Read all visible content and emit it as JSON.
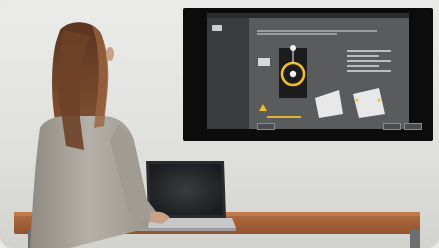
{
  "scene": {
    "caption": "",
    "colors": {
      "wall": "#e6e6e4",
      "desk": "#a5623a",
      "sweater": "#a8a39b",
      "hair": "#7b4a2b",
      "monitor_frame": "#0c0c0d",
      "screen_bg": "#5a5b5d",
      "accent_yellow": "#f2bd2a"
    },
    "icons": {
      "calibration_target": "ring-with-center-dot",
      "colorimeter": "puck-device"
    }
  },
  "monitor_ui": {
    "window_title": "",
    "sidebar_title": "",
    "steps": [],
    "heading": "",
    "buttons": {
      "back": "",
      "next": "",
      "cancel": ""
    },
    "brand": ""
  }
}
